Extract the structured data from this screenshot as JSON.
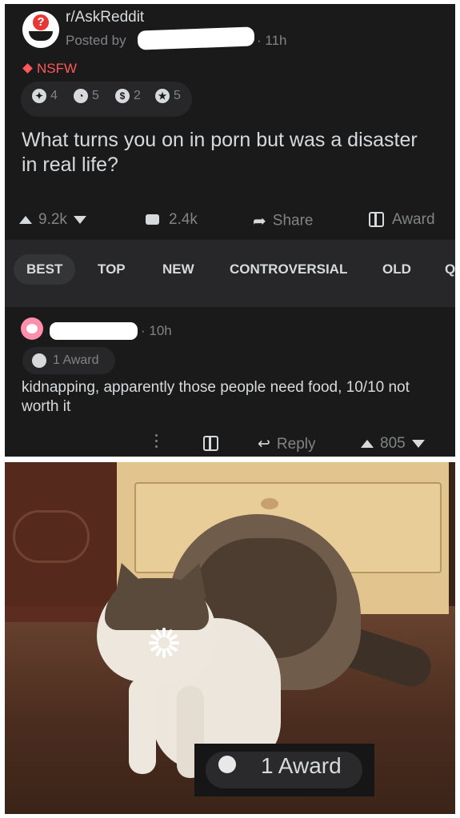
{
  "post": {
    "subreddit": "r/AskReddit",
    "posted_by": "Posted by",
    "age": "· 11h",
    "nsfw": "NSFW",
    "awards": [
      {
        "icon": "award-icon-1",
        "count": "4"
      },
      {
        "icon": "award-icon-2",
        "count": "5"
      },
      {
        "icon": "award-icon-3",
        "count": "2"
      },
      {
        "icon": "award-icon-4",
        "count": "5"
      }
    ],
    "title": "What turns you on in porn but was a disaster in real life?",
    "votes": "9.2k",
    "comments": "2.4k",
    "share": "Share",
    "award": "Award"
  },
  "sort": {
    "tabs": [
      "BEST",
      "TOP",
      "NEW",
      "CONTROVERSIAL",
      "OLD",
      "Q"
    ],
    "active": "BEST"
  },
  "comment": {
    "age": "· 10h",
    "award": "1 Award",
    "text": "kidnapping, apparently those people need food, 10/10 not worth it",
    "reply": "Reply",
    "votes": "805"
  },
  "meme": {
    "award": "1 Award"
  },
  "colors": {
    "background": "#1a1a1b",
    "text": "#d7dadc",
    "muted": "#818384",
    "nsfw": "#ff585b"
  }
}
